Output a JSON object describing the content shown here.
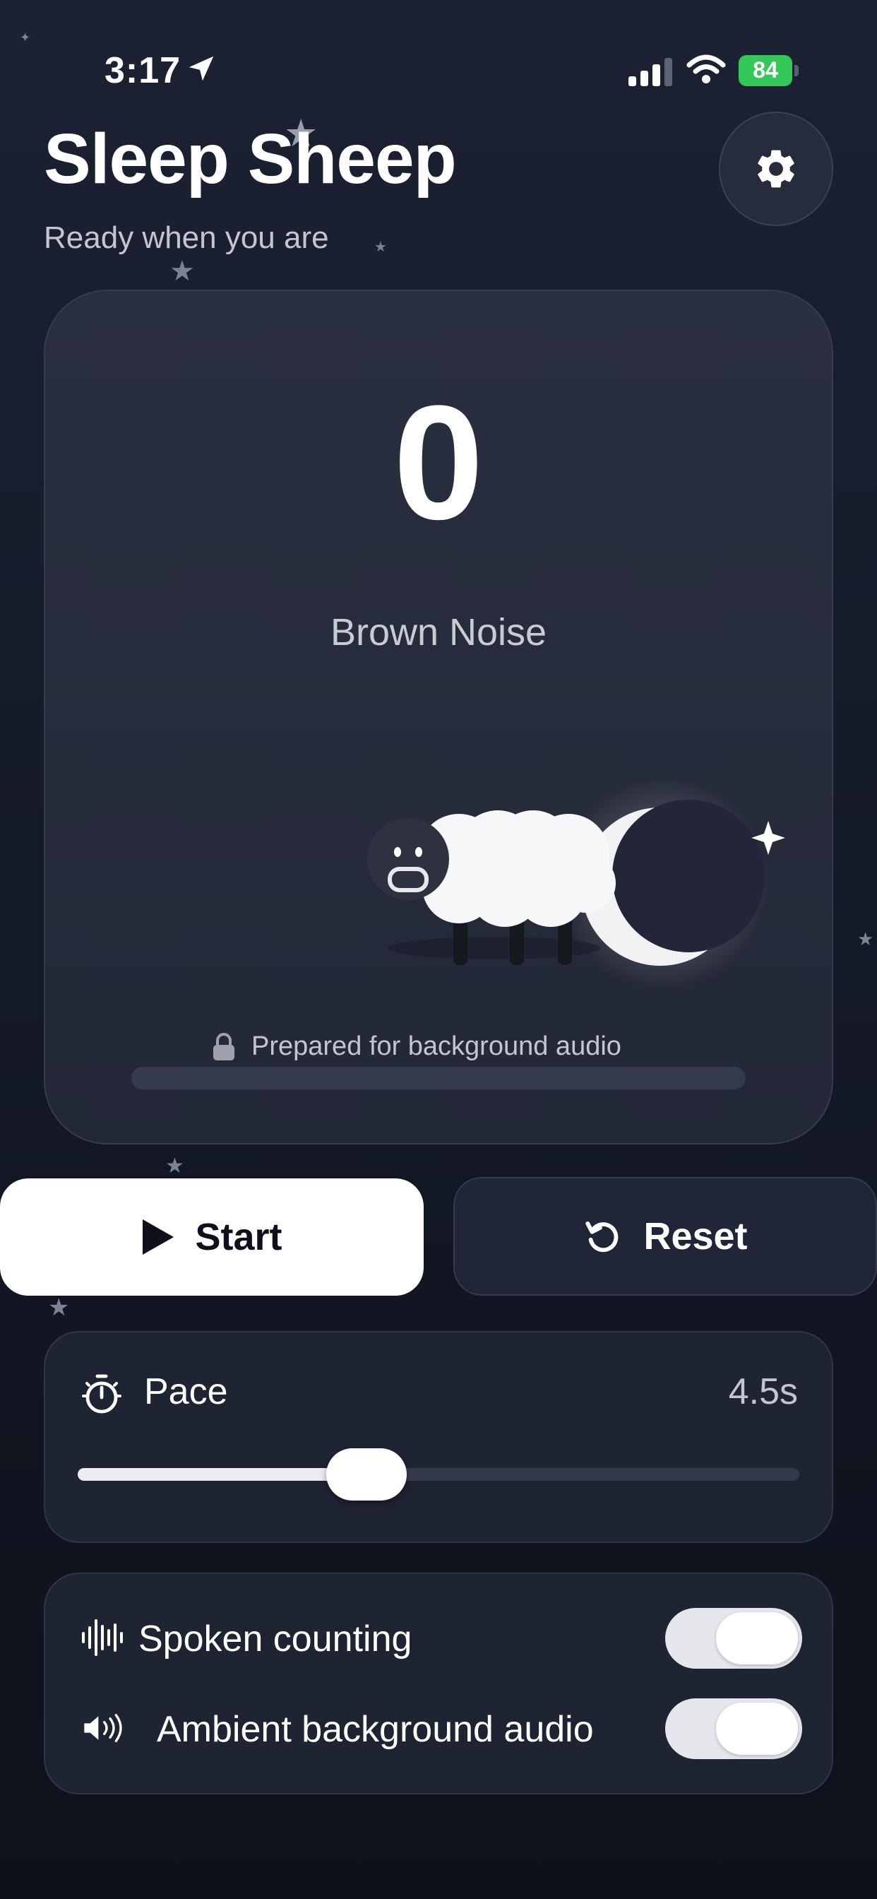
{
  "status_bar": {
    "time": "3:17",
    "battery": "84",
    "icons": [
      "location-arrow-icon",
      "cellular-signal-icon",
      "wifi-icon",
      "battery-charging-icon"
    ]
  },
  "header": {
    "title": "Sleep Sheep",
    "subtitle": "Ready when you are",
    "settings_icon": "gear-icon"
  },
  "counter": {
    "count": "0",
    "sound_name": "Brown Noise",
    "audio_status": "Prepared for background audio",
    "status_icon": "lock-icon"
  },
  "actions": {
    "start_label": "Start",
    "start_icon": "play-icon",
    "reset_label": "Reset",
    "reset_icon": "reset-icon"
  },
  "pace": {
    "label": "Pace",
    "value": "4.5s",
    "slider_fraction": 0.4,
    "icon": "timer-icon"
  },
  "settings": {
    "items": [
      {
        "label": "Spoken counting",
        "icon": "waveform-icon",
        "enabled": true
      },
      {
        "label": "Ambient background audio",
        "icon": "speaker-icon",
        "enabled": true
      }
    ]
  },
  "colors": {
    "background": "#151a28",
    "card": "#262b3a",
    "accent_white": "#ffffff",
    "battery_green": "#34c759"
  }
}
